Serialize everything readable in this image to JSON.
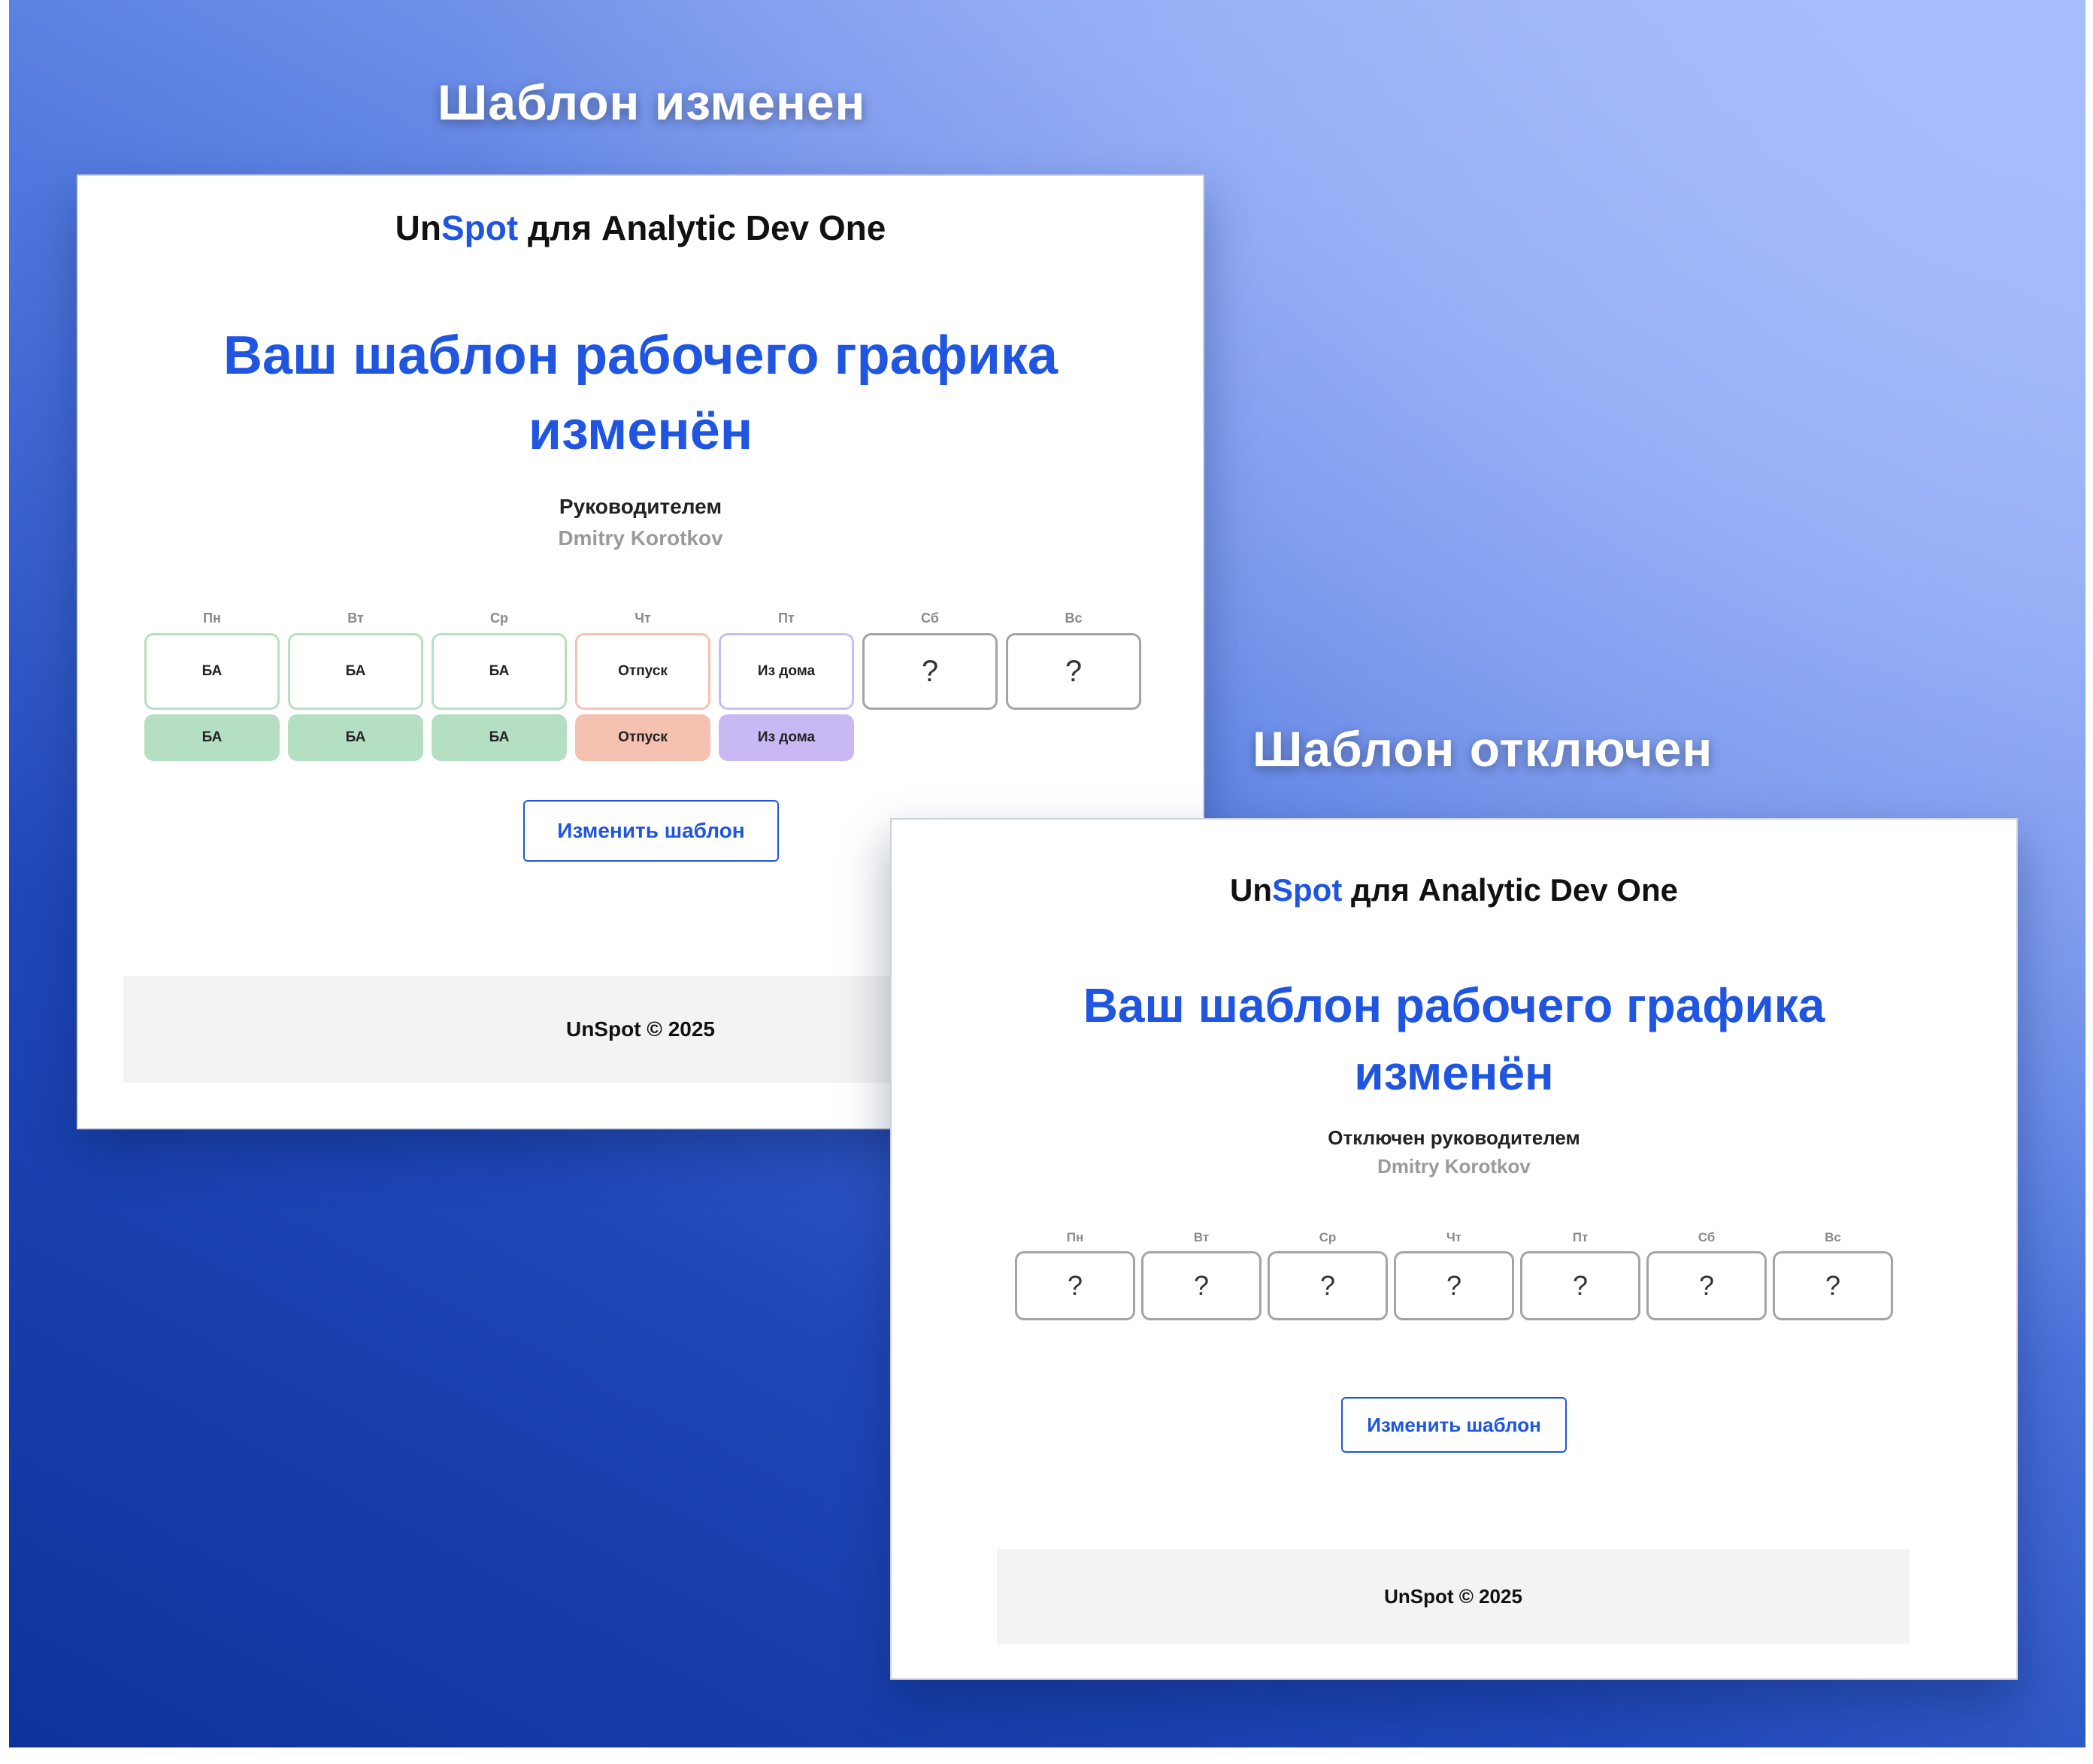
{
  "captions": {
    "changed": "Шаблон изменен",
    "disabled": "Шаблон отключен"
  },
  "brand": {
    "un": "Un",
    "spot": "Spot",
    "rest": " для Analytic Dev One"
  },
  "card_changed": {
    "headline_1": "Ваш шаблон рабочего графика",
    "headline_2": "изменён",
    "by_label": "Руководителем",
    "by_name": "Dmitry Korotkov",
    "days": [
      "Пн",
      "Вт",
      "Ср",
      "Чт",
      "Пт",
      "Сб",
      "Вс"
    ],
    "template": [
      "БА",
      "БА",
      "БА",
      "Отпуск",
      "Из дома",
      "?",
      "?"
    ],
    "actual": [
      "БА",
      "БА",
      "БА",
      "Отпуск",
      "Из дома"
    ],
    "button": "Изменить шаблон",
    "footer": "UnSpot © 2025"
  },
  "card_disabled": {
    "headline_1": "Ваш шаблон рабочего графика",
    "headline_2": "изменён",
    "by_label": "Отключен руководителем",
    "by_name": "Dmitry Korotkov",
    "days": [
      "Пн",
      "Вт",
      "Ср",
      "Чт",
      "Пт",
      "Сб",
      "Вс"
    ],
    "template": [
      "?",
      "?",
      "?",
      "?",
      "?",
      "?",
      "?"
    ],
    "button": "Изменить шаблон",
    "footer": "UnSpot © 2025"
  },
  "colors": {
    "office_border": "#b6e0c1",
    "office_fill": "#b5dfc3",
    "vacation_border": "#f5c2b3",
    "vacation_fill": "#f5c1b1",
    "home_border": "#c9bdf2",
    "home_fill": "#c8b9f5",
    "accent": "#1f55e0"
  }
}
